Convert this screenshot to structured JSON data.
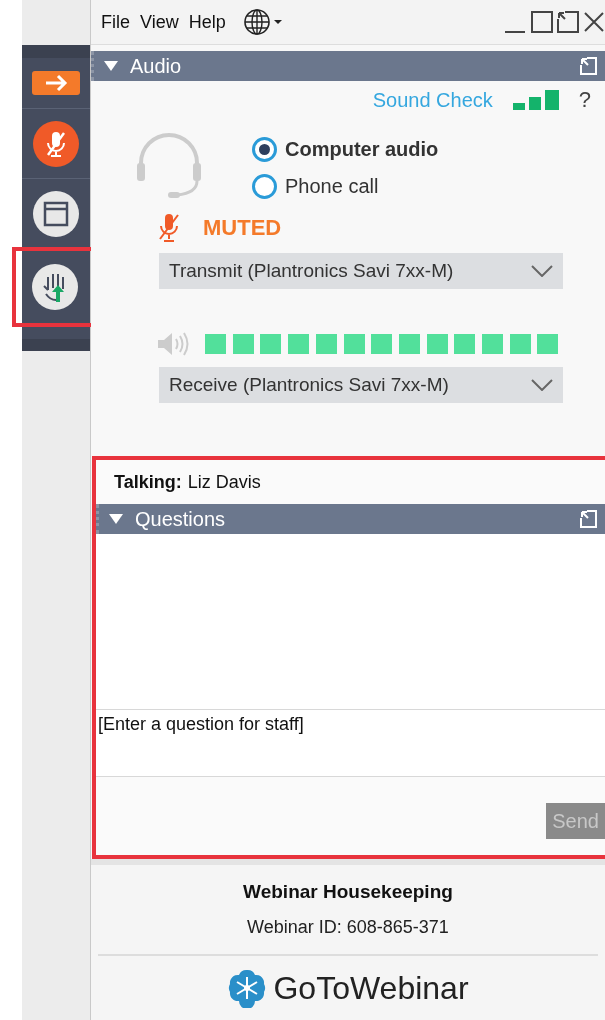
{
  "menu": [
    "File",
    "View",
    "Help"
  ],
  "sidebar": {
    "items": [
      {
        "kind": "arrow"
      },
      {
        "kind": "mic"
      },
      {
        "kind": "window"
      },
      {
        "kind": "hand"
      }
    ]
  },
  "audio": {
    "title": "Audio",
    "expanded": true,
    "sound_check": "Sound Check",
    "help": "?",
    "options": [
      {
        "label": "Computer audio",
        "selected": true
      },
      {
        "label": "Phone call",
        "selected": false
      }
    ],
    "muted": true,
    "mute_label": "MUTED",
    "transmit": "Transmit (Plantronics Savi 7xx-M)",
    "speaker_meter": {
      "level": 1
    },
    "receive": "Receive (Plantronics Savi 7xx-M)"
  },
  "talking": {
    "label": "Talking:",
    "name": "Liz Davis"
  },
  "questions": {
    "title": "Questions",
    "expanded": true,
    "placeholder": "[Enter a question for staff]",
    "send": "Send",
    "send_disabled": true
  },
  "footer": {
    "title": "Webinar Housekeeping",
    "webinar_id": "Webinar ID: 608-865-371",
    "logo": "**GoTo**Webinar"
  }
}
